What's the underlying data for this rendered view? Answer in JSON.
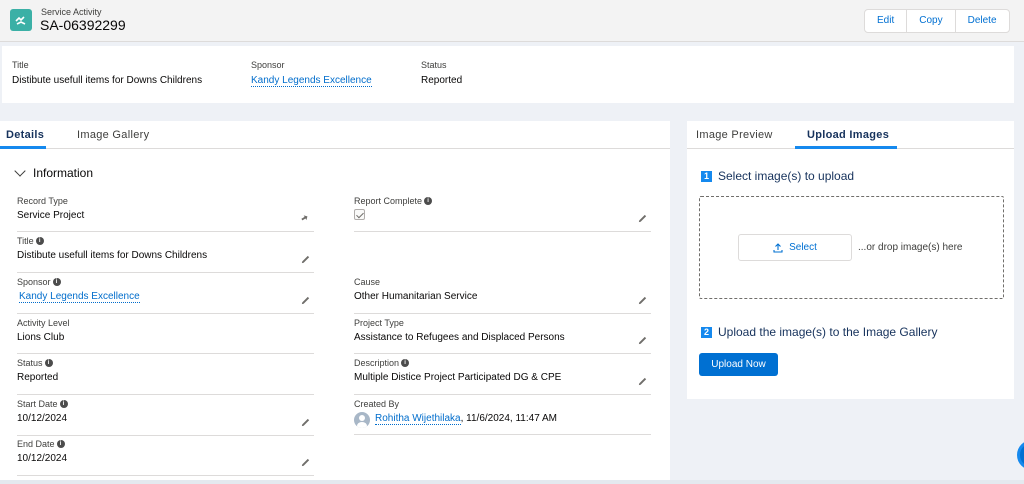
{
  "header": {
    "object_type": "Service Activity",
    "record_name": "SA-06392299",
    "actions": [
      "Edit",
      "Copy",
      "Delete"
    ]
  },
  "highlights": {
    "title_label": "Title",
    "title_value": "Distibute usefull items for Downs Childrens",
    "sponsor_label": "Sponsor",
    "sponsor_value": "Kandy Legends Excellence",
    "status_label": "Status",
    "status_value": "Reported"
  },
  "left_tabs": [
    "Details",
    "Image Gallery"
  ],
  "section": {
    "title": "Information"
  },
  "fields": {
    "record_type": {
      "label": "Record Type",
      "value": "Service Project"
    },
    "report_complete": {
      "label": "Report Complete",
      "value": true
    },
    "title": {
      "label": "Title",
      "value": "Distibute usefull items for Downs Childrens"
    },
    "sponsor": {
      "label": "Sponsor",
      "value": "Kandy Legends Excellence"
    },
    "cause": {
      "label": "Cause",
      "value": "Other Humanitarian Service"
    },
    "activity_level": {
      "label": "Activity Level",
      "value": "Lions Club"
    },
    "project_type": {
      "label": "Project Type",
      "value": "Assistance to Refugees and Displaced Persons"
    },
    "status": {
      "label": "Status",
      "value": "Reported"
    },
    "description": {
      "label": "Description",
      "value": "Multiple Distice Project Participated DG & CPE"
    },
    "start_date": {
      "label": "Start Date",
      "value": "10/12/2024"
    },
    "created_by": {
      "label": "Created By",
      "user": "Rohitha Wijethilaka",
      "timestamp": ", 11/6/2024, 11:47 AM"
    },
    "end_date": {
      "label": "End Date",
      "value": "10/12/2024"
    }
  },
  "right_tabs": [
    "Image Preview",
    "Upload Images"
  ],
  "upload": {
    "step1_num": "1",
    "step1_text": "Select image(s) to upload",
    "select_label": "Select",
    "drop_text": "...or drop image(s) here",
    "step2_num": "2",
    "step2_text": "Upload the image(s) to the Image Gallery",
    "upload_button": "Upload Now"
  },
  "colors": {
    "brand": "#0070d2",
    "accent": "#1589ee",
    "object_icon": "#3bb0a6"
  }
}
